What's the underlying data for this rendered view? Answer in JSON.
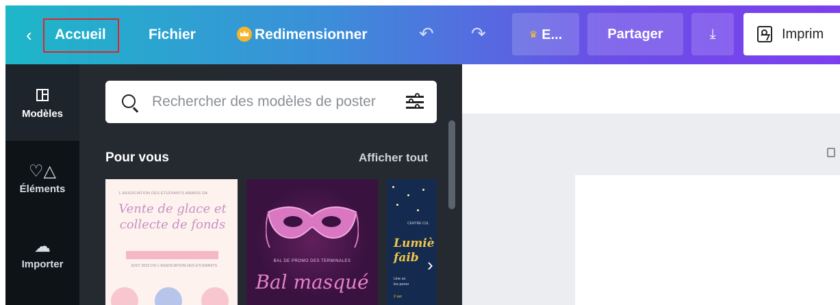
{
  "topbar": {
    "back_icon": "chevron-left-icon",
    "home_label": "Accueil",
    "file_label": "Fichier",
    "resize_label": "Redimensionner",
    "undo_icon": "undo-icon",
    "redo_icon": "redo-icon",
    "premium_label": "E...",
    "share_label": "Partager",
    "download_icon": "download-icon",
    "print_label": "Imprim",
    "accent_gradient": [
      "#1db7c8",
      "#3b8fd9",
      "#6a4ee6",
      "#7c3ff0"
    ],
    "highlight_color": "#e02424"
  },
  "rail": {
    "items": [
      {
        "label": "Modèles",
        "icon": "templates-icon"
      },
      {
        "label": "Éléments",
        "icon": "elements-icon"
      },
      {
        "label": "Importer",
        "icon": "upload-cloud-icon"
      }
    ]
  },
  "panel": {
    "search_placeholder": "Rechercher des modèles de poster",
    "section_title": "Pour vous",
    "see_all_label": "Afficher tout",
    "templates": [
      {
        "small_text": "L'ASSOCIATION DES ÉTUDIANTS AMARIS DA",
        "title_line1": "Vente de glace et",
        "title_line2": "collecte de fonds",
        "sub_text": "JUST 2023 D'E L'ASSOCIATION DES ÉTUDIANTS"
      },
      {
        "small_text": "BAL DE PROMO DES TERMINALES",
        "title": "Bal masqué"
      },
      {
        "small_text_top": "CENTRE CUL",
        "title_line1": "Lumiè",
        "title_line2": "faib",
        "small_text_1": "Une so",
        "small_text_2": "les perso",
        "small_text_3": "2 avr"
      }
    ]
  }
}
